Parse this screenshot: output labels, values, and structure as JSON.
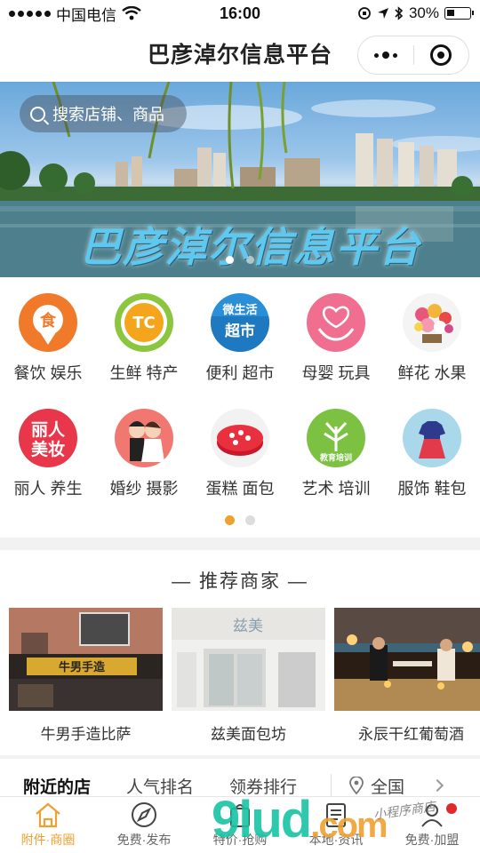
{
  "status_bar": {
    "carrier": "中国电信",
    "time": "16:00",
    "battery": "30%"
  },
  "nav": {
    "title": "巴彦淖尔信息平台"
  },
  "banner": {
    "search_placeholder": "搜索店铺、商品",
    "caption": "巴彦淖尔信息平台",
    "slide_count": 2,
    "active_slide": 1
  },
  "categories": [
    {
      "label": "餐饮 娱乐",
      "icon": "food-icon",
      "color": "#f07a2a"
    },
    {
      "label": "生鲜 特产",
      "icon": "specialty-icon",
      "color": "#8cc63f"
    },
    {
      "label": "便利 超市",
      "icon": "supermarket-icon",
      "color": "#2a8fd6"
    },
    {
      "label": "母婴 玩具",
      "icon": "maternity-icon",
      "color": "#f06e90"
    },
    {
      "label": "鲜花 水果",
      "icon": "flower-icon",
      "color": "#f4f4f4"
    },
    {
      "label": "丽人 养生",
      "icon": "beauty-icon",
      "color": "#e8364a"
    },
    {
      "label": "婚纱 摄影",
      "icon": "wedding-icon",
      "color": "#f07870"
    },
    {
      "label": "蛋糕 面包",
      "icon": "cake-icon",
      "color": "#f2f2f2"
    },
    {
      "label": "艺术 培训",
      "icon": "training-icon",
      "color": "#7cc142"
    },
    {
      "label": "服饰 鞋包",
      "icon": "clothing-icon",
      "color": "#a8d8ea"
    }
  ],
  "category_pages": {
    "count": 2,
    "active": 1
  },
  "recommend": {
    "title": "— 推荐商家 —",
    "shops": [
      {
        "name": "牛男手造比萨",
        "sign": "牛男手造"
      },
      {
        "name": "兹美面包坊",
        "sign": "兹美"
      },
      {
        "name": "永辰干红葡萄酒"
      }
    ]
  },
  "tabs": {
    "items": [
      "附近的店",
      "人气排名",
      "领券排行"
    ],
    "active": 0,
    "region": "全国"
  },
  "tabbar": {
    "items": [
      {
        "label": "附件·商圈",
        "icon": "home-icon"
      },
      {
        "label": "免费·发布",
        "icon": "compass-icon"
      },
      {
        "label": "特价·抢购",
        "icon": "bag-icon"
      },
      {
        "label": "本地·资讯",
        "icon": "news-icon"
      },
      {
        "label": "免费·加盟",
        "icon": "user-icon"
      }
    ],
    "active": 0,
    "active_color": "#f0a030"
  },
  "watermark": {
    "text": "9lud",
    "suffix": ".com",
    "script": "小程序商店"
  }
}
